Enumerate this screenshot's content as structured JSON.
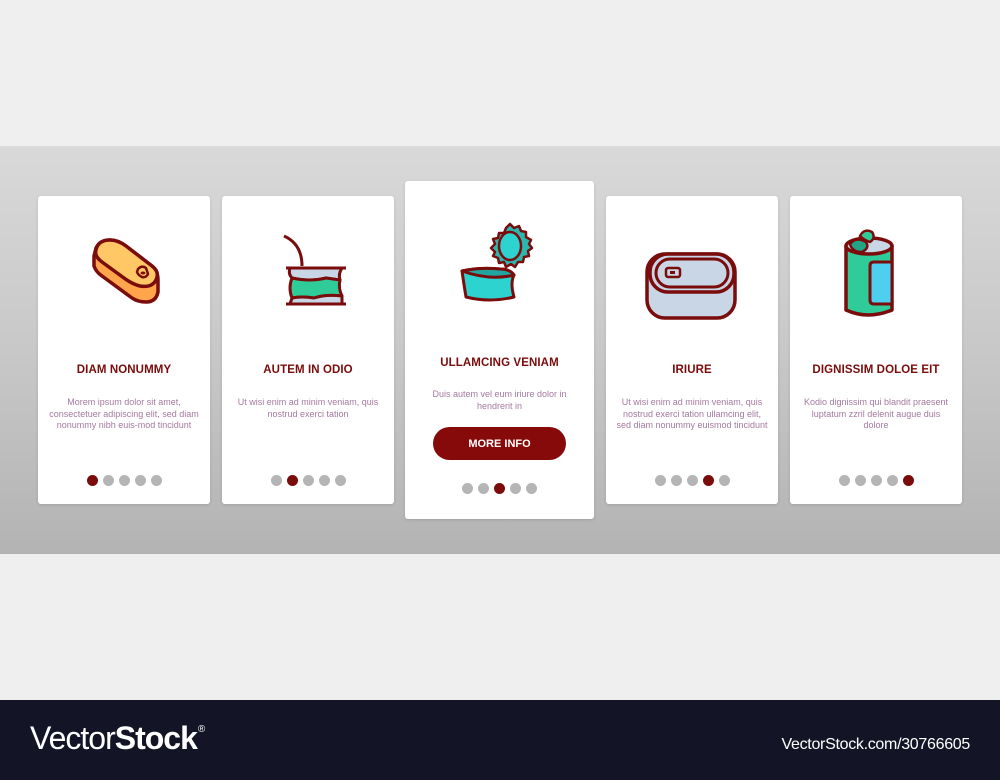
{
  "colors": {
    "accent": "#7a0c0c",
    "button": "#860a0a",
    "description": "#a47aa0",
    "dot_inactive": "#b5b5b5",
    "footer_bg": "#131527"
  },
  "cards": [
    {
      "icon": "sardine-can-icon",
      "title": "DIAM NONUMMY",
      "description": "Morem ipsum dolor sit amet, consectetuer adipiscing elit, sed diam nonummy nibh euis-mod tincidunt",
      "active_dot": 1
    },
    {
      "icon": "opened-can-icon",
      "title": "AUTEM IN ODIO",
      "description": "Ut wisi enim ad minim veniam, quis nostrud exerci tation",
      "active_dot": 2
    },
    {
      "icon": "open-tin-with-lid-icon",
      "title": "ULLAMCING VENIAM",
      "description": "Duis autem vel eum iriure dolor in hendrerit in",
      "button_label": "MORE INFO",
      "active_dot": 3
    },
    {
      "icon": "closed-tin-can-icon",
      "title": "IRIURE",
      "description": "Ut wisi enim ad minim veniam, quis nostrud exerci tation ullamcing elit, sed diam nonummy euismod tincidunt",
      "active_dot": 4
    },
    {
      "icon": "open-cylinder-can-icon",
      "title": "DIGNISSIM DOLOE EIT",
      "description": "Kodio dignissim qui blandit praesent luptatum zzril delenit augue duis dolore",
      "active_dot": 5
    }
  ],
  "pagination": {
    "total_dots": 5
  },
  "footer": {
    "logo_light": "Vector",
    "logo_bold": "Stock",
    "logo_mark": "®",
    "stock_id": "VectorStock.com/30766605"
  }
}
